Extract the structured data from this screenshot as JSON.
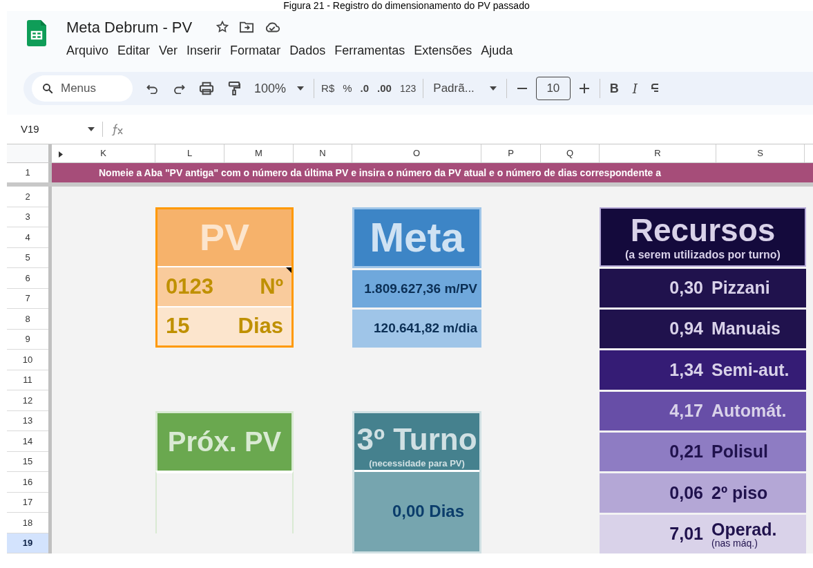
{
  "caption": "Figura 21 - Registro do dimensionamento do PV passado",
  "document": {
    "title": "Meta Debrum - PV"
  },
  "menu": [
    "Arquivo",
    "Editar",
    "Ver",
    "Inserir",
    "Formatar",
    "Dados",
    "Ferramentas",
    "Extensões",
    "Ajuda"
  ],
  "toolbar": {
    "search_placeholder": "Menus",
    "zoom": "100%",
    "currency": "R$",
    "percent": "%",
    "decrease_decimals": ".0",
    "increase_decimals": ".00",
    "number_format": "123",
    "font": "Padrã...",
    "font_size": "10",
    "bold": "B",
    "italic": "I"
  },
  "formula_bar": {
    "name_box": "V19"
  },
  "columns": [
    {
      "label": "K",
      "selected": false
    },
    {
      "label": "L",
      "selected": false
    },
    {
      "label": "M",
      "selected": false
    },
    {
      "label": "N",
      "selected": false
    },
    {
      "label": "O",
      "selected": false
    },
    {
      "label": "P",
      "selected": false
    },
    {
      "label": "Q",
      "selected": false
    },
    {
      "label": "R",
      "selected": false
    },
    {
      "label": "S",
      "selected": false
    }
  ],
  "rows": [
    {
      "label": "1",
      "selected": false
    },
    {
      "label": "2",
      "selected": false
    },
    {
      "label": "3",
      "selected": false
    },
    {
      "label": "4",
      "selected": false
    },
    {
      "label": "5",
      "selected": false
    },
    {
      "label": "6",
      "selected": false
    },
    {
      "label": "7",
      "selected": false
    },
    {
      "label": "8",
      "selected": false
    },
    {
      "label": "9",
      "selected": false
    },
    {
      "label": "10",
      "selected": false
    },
    {
      "label": "11",
      "selected": false
    },
    {
      "label": "12",
      "selected": false
    },
    {
      "label": "13",
      "selected": false
    },
    {
      "label": "14",
      "selected": false
    },
    {
      "label": "15",
      "selected": false
    },
    {
      "label": "16",
      "selected": false
    },
    {
      "label": "17",
      "selected": false
    },
    {
      "label": "18",
      "selected": false
    },
    {
      "label": "19",
      "selected": true
    }
  ],
  "banner": "Nomeie a Aba \"PV antiga\" com o número da última PV e insira o número da PV atual e o número de dias correspondente a",
  "pv": {
    "title": "PV",
    "rows": [
      {
        "value": "0123",
        "unit": "Nº",
        "has_note": true
      },
      {
        "value": "15",
        "unit": "Dias",
        "has_note": false
      }
    ]
  },
  "meta": {
    "title": "Meta",
    "rows": [
      "1.809.627,36 m/PV",
      "120.641,82 m/dia"
    ]
  },
  "recursos": {
    "title": "Recursos",
    "subtitle": "(a serem utilizados por turno)",
    "items": [
      {
        "value": "0,30",
        "label": "Pizzani",
        "color": "#20124d"
      },
      {
        "value": "0,94",
        "label": "Manuais",
        "color": "#20124d"
      },
      {
        "value": "1,34",
        "label": "Semi-aut.",
        "color": "#351c75"
      },
      {
        "value": "4,17",
        "label": "Automát.",
        "color": "#674ea7"
      },
      {
        "value": "0,21",
        "label": "Polisul",
        "color": "#8e7cc3"
      },
      {
        "value": "0,06",
        "label": "2º piso",
        "color": "#b4a7d6"
      },
      {
        "value": "7,01",
        "label": "Operad.",
        "note": "(nas máq.)",
        "color": "#d9d2e9"
      }
    ]
  },
  "proxima_pv": {
    "title": "Próx. PV"
  },
  "terceiro_turno": {
    "title": "3º Turno",
    "subtitle": "(necessidade para PV)",
    "value": "0,00 Dias"
  }
}
